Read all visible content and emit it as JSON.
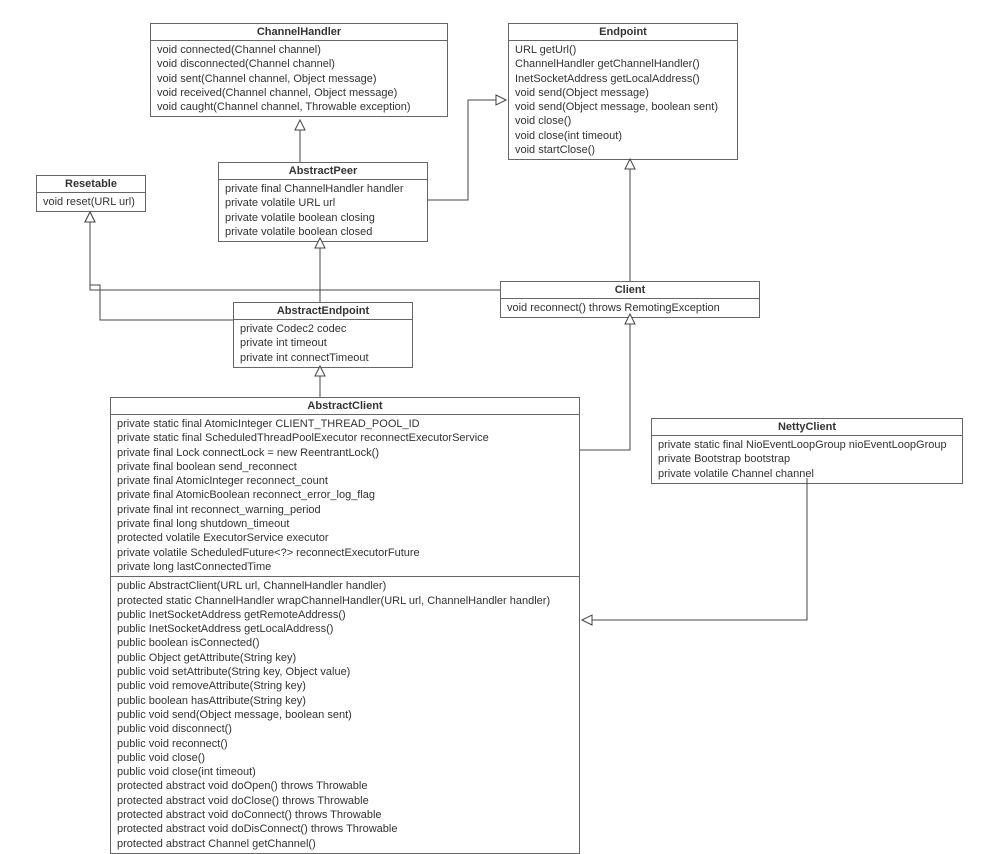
{
  "boxes": {
    "channelHandler": {
      "title": "ChannelHandler",
      "m": [
        "void connected(Channel channel)",
        "void disconnected(Channel channel)",
        "void sent(Channel channel, Object message)",
        "void received(Channel channel, Object message)",
        "void caught(Channel channel, Throwable exception)"
      ]
    },
    "endpoint": {
      "title": "Endpoint",
      "m": [
        "URL getUrl()",
        "ChannelHandler getChannelHandler()",
        "InetSocketAddress getLocalAddress()",
        "void send(Object message)",
        "void send(Object message, boolean sent)",
        "void close()",
        "void close(int timeout)",
        "void startClose()"
      ]
    },
    "resetable": {
      "title": "Resetable",
      "m": [
        "void reset(URL url)"
      ]
    },
    "abstractPeer": {
      "title": "AbstractPeer",
      "m": [
        "private final ChannelHandler handler",
        "private volatile URL url",
        "private volatile boolean closing",
        "private volatile boolean closed"
      ]
    },
    "abstractEndpoint": {
      "title": "AbstractEndpoint",
      "m": [
        "private Codec2 codec",
        "private int timeout",
        "private int connectTimeout"
      ]
    },
    "client": {
      "title": "Client",
      "m": [
        "void reconnect() throws RemotingException"
      ]
    },
    "abstractClient": {
      "title": "AbstractClient",
      "f": [
        "private static final AtomicInteger CLIENT_THREAD_POOL_ID",
        "private static final ScheduledThreadPoolExecutor reconnectExecutorService",
        "private final Lock connectLock = new ReentrantLock()",
        "private final boolean send_reconnect",
        "private final AtomicInteger reconnect_count",
        "private final AtomicBoolean reconnect_error_log_flag",
        "private final int reconnect_warning_period",
        "private final long shutdown_timeout",
        "protected volatile ExecutorService executor",
        "private volatile ScheduledFuture<?> reconnectExecutorFuture",
        "private long lastConnectedTime"
      ],
      "m2": [
        "public AbstractClient(URL url, ChannelHandler handler)",
        "protected static ChannelHandler wrapChannelHandler(URL url, ChannelHandler handler)",
        "public InetSocketAddress getRemoteAddress()",
        "public InetSocketAddress getLocalAddress()",
        "public boolean isConnected()",
        "public Object getAttribute(String key)",
        "public void setAttribute(String key, Object value)",
        "public void removeAttribute(String key)",
        "public boolean hasAttribute(String key)",
        "public void send(Object message, boolean sent)",
        "public void disconnect()",
        "public void reconnect()",
        "public void close()",
        "public void close(int timeout)",
        "protected abstract void doOpen() throws Throwable",
        "protected abstract void doClose() throws Throwable",
        "protected abstract void doConnect() throws Throwable",
        "protected abstract void doDisConnect() throws Throwable",
        "protected abstract Channel getChannel()"
      ]
    },
    "nettyClient": {
      "title": "NettyClient",
      "m": [
        "private static final NioEventLoopGroup nioEventLoopGroup",
        "private Bootstrap bootstrap",
        "private volatile Channel channel"
      ]
    }
  }
}
